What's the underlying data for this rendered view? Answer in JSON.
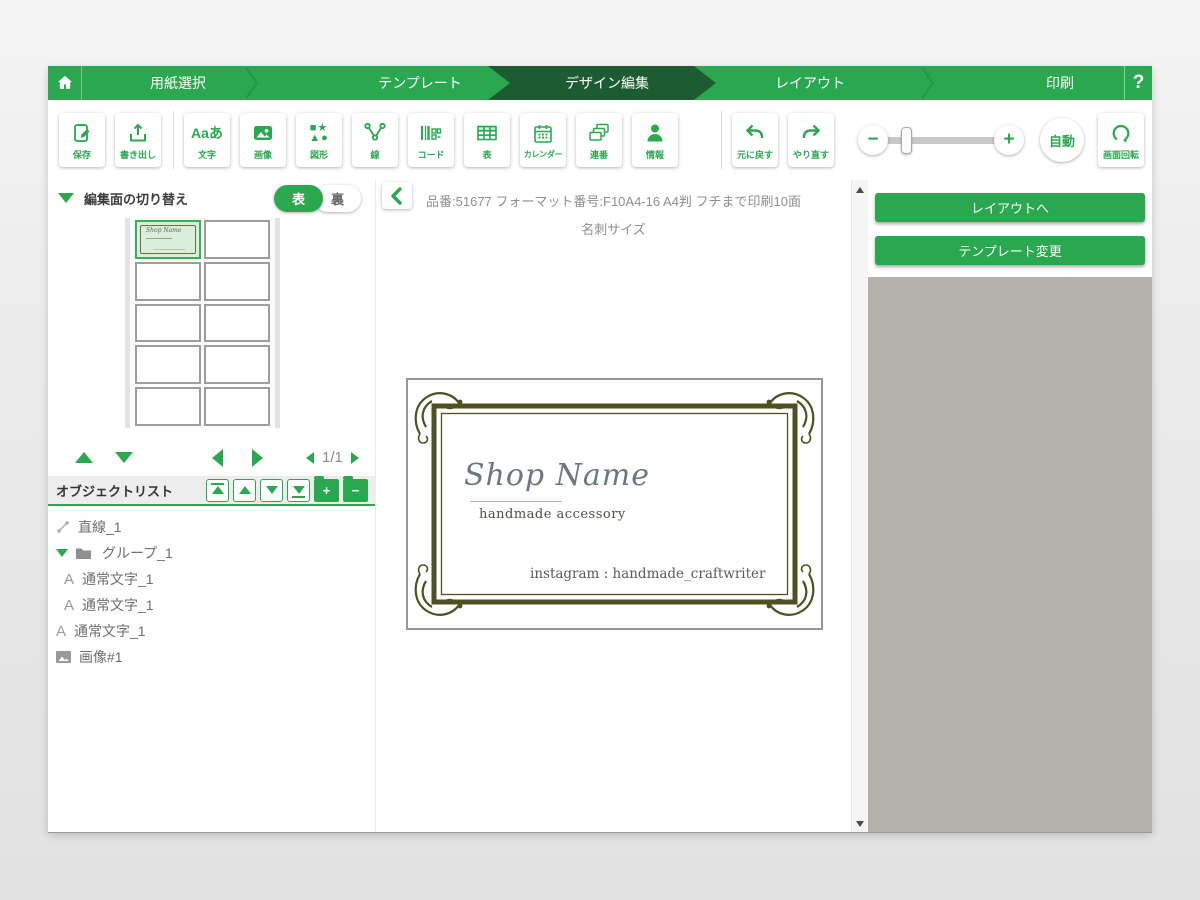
{
  "colors": {
    "accent": "#2aa84f",
    "accent_dark": "#1d5c32",
    "panel_gray": "#b3b1a9",
    "frame_olive": "#4d511f"
  },
  "nav": {
    "steps": [
      {
        "label": "用紙選択"
      },
      {
        "label": "テンプレート"
      },
      {
        "label": "デザイン編集"
      },
      {
        "label": "レイアウト"
      },
      {
        "label": "印刷"
      }
    ],
    "active_step": "デザイン編集",
    "help_label": "?"
  },
  "toolbar": {
    "save": {
      "label": "保存"
    },
    "export": {
      "label": "書き出し"
    },
    "text": {
      "label": "文字",
      "icon_text": "Aaあ"
    },
    "image": {
      "label": "画像"
    },
    "shape": {
      "label": "図形",
      "icon_line1": "■★",
      "icon_line2": "▲●"
    },
    "line": {
      "label": "線"
    },
    "code": {
      "label": "コード"
    },
    "table": {
      "label": "表"
    },
    "calendar": {
      "label": "カレンダー"
    },
    "serial": {
      "label": "連番"
    },
    "info": {
      "label": "情報"
    },
    "undo": {
      "label": "元に戻す"
    },
    "redo": {
      "label": "やり直す"
    },
    "zoom": {
      "minus": "−",
      "plus": "+",
      "auto": "自動"
    },
    "rotate": {
      "label": "画面回転"
    }
  },
  "left_panel": {
    "switch_title": "編集面の切り替え",
    "front_label": "表",
    "back_label": "裏",
    "page_indicator": "1/1",
    "object_list_title": "オブジェクトリスト",
    "objects": [
      {
        "type": "line",
        "label": "直線_1"
      },
      {
        "type": "group",
        "label": "グループ_1"
      },
      {
        "type": "text",
        "label": "通常文字_1"
      },
      {
        "type": "text",
        "label": "通常文字_1"
      },
      {
        "type": "text",
        "label": "通常文字_1"
      },
      {
        "type": "image",
        "label": "画像#1"
      }
    ]
  },
  "canvas": {
    "product_info": "品番:51677 フォーマット番号:F10A4-16 A4判 フチまで印刷10面 名刺サイズ",
    "card": {
      "shop_name": "Shop Name",
      "subtitle": "handmade accessory",
      "instagram": "instagram : handmade_craftwriter"
    }
  },
  "right_panel": {
    "to_layout_label": "レイアウトへ",
    "change_template_label": "テンプレート変更"
  }
}
